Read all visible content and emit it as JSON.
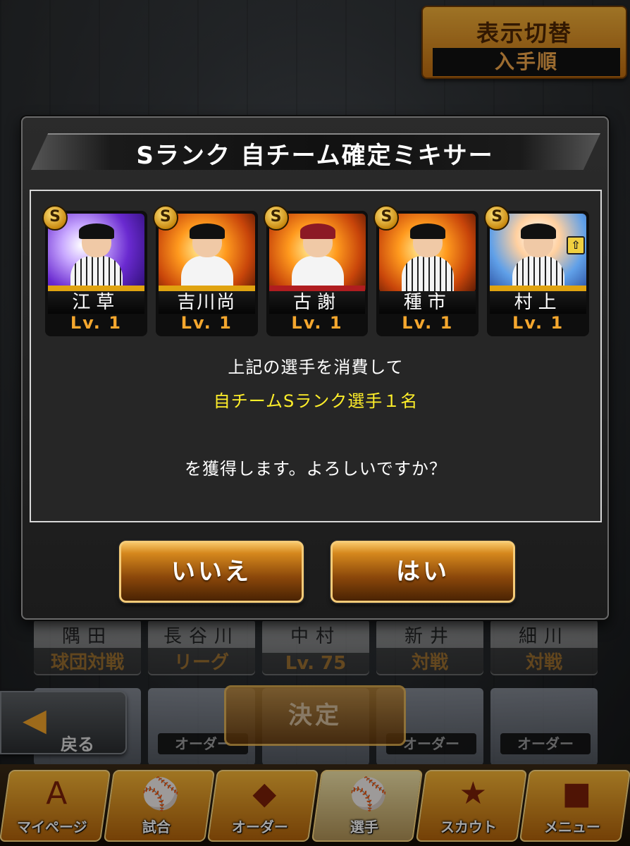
{
  "display_toggle": {
    "title": "表示切替",
    "value": "入手順"
  },
  "background_rows": {
    "mid": [
      {
        "name": "隅田",
        "sub": "球団対戦"
      },
      {
        "name": "長谷川",
        "sub": "リーグ"
      },
      {
        "name": "中村",
        "sub": "Lv. 75"
      },
      {
        "name": "新井",
        "sub": "対戦"
      },
      {
        "name": "細川",
        "sub": "対戦"
      }
    ],
    "order_label": "オーダー"
  },
  "back_button": {
    "label": "戻る"
  },
  "decide_button": {
    "label": "決定"
  },
  "tabs": [
    {
      "label": "マイページ",
      "icon": "A"
    },
    {
      "label": "試合",
      "icon": "⚾"
    },
    {
      "label": "オーダー",
      "icon": "◆"
    },
    {
      "label": "選手",
      "icon": "⚾"
    },
    {
      "label": "スカウト",
      "icon": "★"
    },
    {
      "label": "メニュー",
      "icon": "■"
    }
  ],
  "modal": {
    "title": "Sランク 自チーム確定ミキサー",
    "cards": [
      {
        "rank": "S",
        "name": "江草",
        "level": "Lv. 1"
      },
      {
        "rank": "S",
        "name": "吉川尚",
        "level": "Lv. 1"
      },
      {
        "rank": "S",
        "name": "古謝",
        "level": "Lv. 1"
      },
      {
        "rank": "S",
        "name": "種市",
        "level": "Lv. 1"
      },
      {
        "rank": "S",
        "name": "村上",
        "level": "Lv. 1"
      }
    ],
    "message_line1": "上記の選手を消費して",
    "message_highlight": "自チームSランク選手１名",
    "message_line3": "を獲得します。よろしいですか？",
    "highlight_color": "#ffef2a",
    "no_label": "いいえ",
    "yes_label": "はい"
  }
}
